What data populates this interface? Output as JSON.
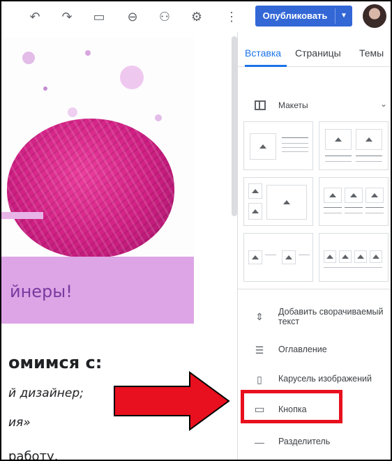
{
  "toolbar": {
    "publish_label": "Опубликовать",
    "icons": [
      "undo-icon",
      "redo-icon",
      "preview-icon",
      "link-icon",
      "share-icon",
      "settings-icon",
      "more-icon"
    ]
  },
  "page": {
    "title_fragment": "йнеры!",
    "heading_fragment": "омимся с:",
    "line1": "й дизайнер;",
    "line2": "ия»",
    "line3": "работу."
  },
  "sidebar": {
    "tabs": [
      {
        "label": "Вставка",
        "active": true
      },
      {
        "label": "Страницы",
        "active": false
      },
      {
        "label": "Темы",
        "active": false
      }
    ],
    "layouts_label": "Макеты",
    "items": [
      {
        "label": "Добавить сворачиваемый текст",
        "icon": "collapsible-text-icon"
      },
      {
        "label": "Оглавление",
        "icon": "table-of-contents-icon"
      },
      {
        "label": "Карусель изображений",
        "icon": "carousel-icon"
      },
      {
        "label": "Кнопка",
        "icon": "button-icon"
      },
      {
        "label": "Разделитель",
        "icon": "divider-icon"
      }
    ]
  },
  "colors": {
    "accent": "#1a73e8",
    "publish": "#3367d6",
    "highlight": "#e8101e",
    "band": "#dda4e6",
    "yarn": "#cf1f83"
  }
}
